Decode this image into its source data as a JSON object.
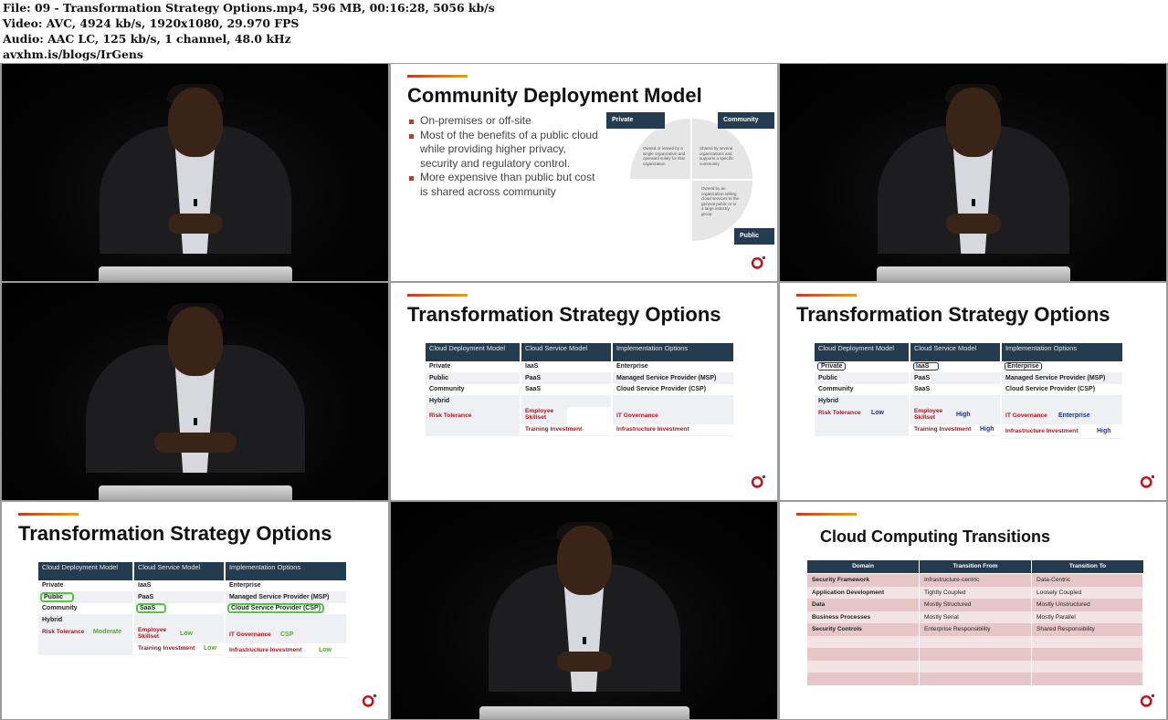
{
  "info": {
    "line1": "File: 09 - Transformation Strategy Options.mp4, 596 MB, 00:16:28, 5056 kb/s",
    "line2": "Video: AVC, 4924 kb/s, 1920x1080, 29.970 FPS",
    "line3": "Audio: AAC LC, 125 kb/s, 1 channel, 48.0 kHz",
    "line4": "avxhm.is/blogs/IrGens"
  },
  "slide_community": {
    "title": "Community Deployment Model",
    "bullets": [
      "On-premises or off-site",
      "Most of the benefits of a public cloud while providing higher privacy, security and regulatory control.",
      "More expensive than public but cost is shared across community"
    ],
    "tag_private": "Private",
    "tag_community": "Community",
    "tag_public": "Public",
    "q_private": "Owned or leased by a single organization and operated solely for that organization",
    "q_community": "Shared by several organizations and supports a specific community",
    "q_public": "Owned by an organization selling cloud services to the general public or to a large industry group"
  },
  "tso": {
    "title": "Transformation Strategy Options",
    "h_deploy": "Cloud Deployment Model",
    "h_service": "Cloud Service Model",
    "h_impl": "Implementation Options",
    "deploy": [
      "Private",
      "Public",
      "Community",
      "Hybrid"
    ],
    "service": [
      "IaaS",
      "PaaS",
      "SaaS"
    ],
    "impl": [
      "Enterprise",
      "Managed Service Provider (MSP)",
      "Cloud Service Provider (CSP)"
    ],
    "risk": "Risk Tolerance",
    "skill": "Employee Skillset",
    "training": "Training Investment",
    "gov": "IT Governance",
    "infra": "Infrastructure Investment"
  },
  "tso_blue": {
    "risk_level": "Low",
    "skill_level": "High",
    "training_level": "High",
    "gov_level": "Enterprise",
    "infra_level": "High"
  },
  "tso_green": {
    "risk_level": "Moderate",
    "skill_level": "Low",
    "training_level": "Low",
    "gov_level": "CSP",
    "infra_level": "Low"
  },
  "transitions": {
    "title": "Cloud Computing Transitions",
    "headers": [
      "Domain",
      "Transition From",
      "Transition To"
    ],
    "rows": [
      [
        "Security Framework",
        "Infrastructure-centric",
        "Data-Centric"
      ],
      [
        "Application Development",
        "Tightly Coupled",
        "Loosely Coupled"
      ],
      [
        "Data",
        "Mostly Structured",
        "Mostly Unstructured"
      ],
      [
        "Business Processes",
        "Mostly Serial",
        "Mostly Parallel"
      ],
      [
        "Security Controls",
        "Enterprise Responsibility",
        "Shared Responsibility"
      ],
      [
        "",
        "",
        ""
      ],
      [
        "",
        "",
        ""
      ],
      [
        "",
        "",
        ""
      ],
      [
        "",
        "",
        ""
      ]
    ]
  },
  "colors": {
    "navy": "#253b4f",
    "red": "#b0121b",
    "blue_highlight": "#1a2da0",
    "green_highlight": "#4ccc3a"
  }
}
